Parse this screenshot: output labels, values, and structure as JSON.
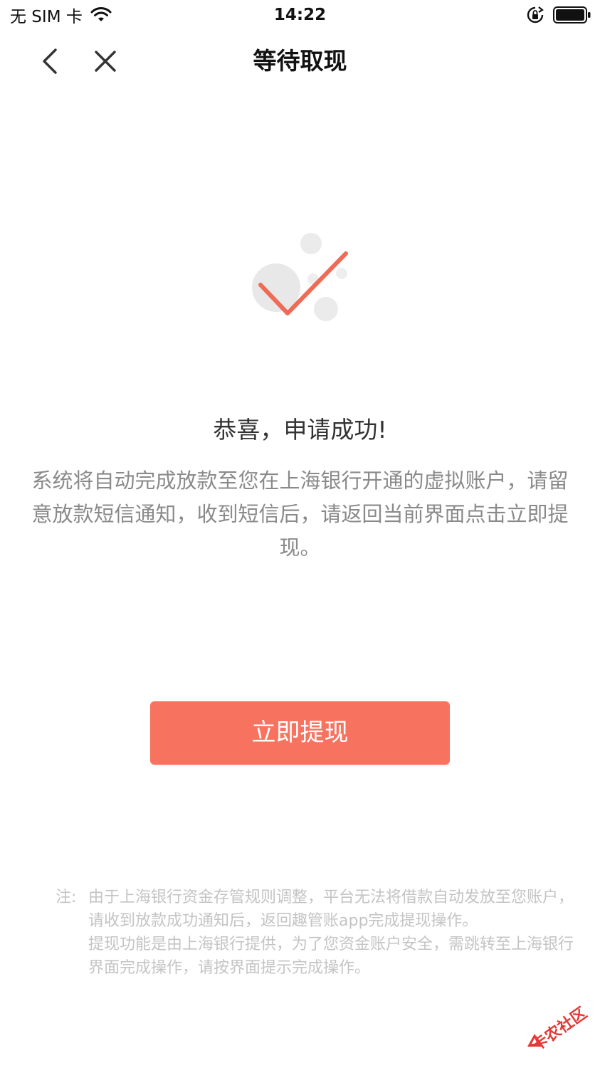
{
  "status_bar": {
    "carrier": "无 SIM 卡",
    "time": "14:22"
  },
  "nav": {
    "title": "等待取现"
  },
  "result": {
    "title": "恭喜，申请成功!",
    "description": "系统将自动完成放款至您在上海银行开通的虚拟账户，请留意放款短信通知，收到短信后，请返回当前界面点击立即提现。"
  },
  "action": {
    "withdraw_label": "立即提现",
    "button_color": "#f7735f"
  },
  "note": {
    "label": "注:",
    "line1": "由于上海银行资金存管规则调整，平台无法将借款自动发放至您账户，请收到放款成功通知后，返回趣管账app完成提现操作。",
    "line2": "提现功能是由上海银行提供，为了您资金账户安全，需跳转至上海银行界面完成操作，请按界面提示完成操作。"
  },
  "watermark": {
    "text": "卡农社区"
  },
  "colors": {
    "accent": "#f7735f",
    "check": "#ef6b55",
    "bubble": "#e8e8e8"
  }
}
